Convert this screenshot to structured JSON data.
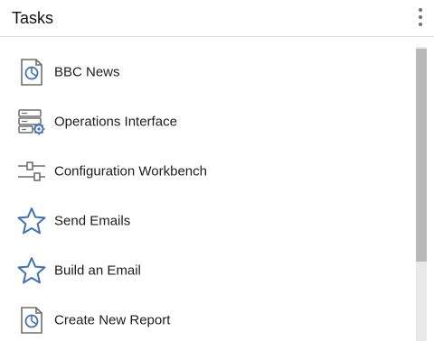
{
  "header": {
    "title": "Tasks",
    "menu_icon": "more-vertical-icon"
  },
  "tasks": [
    {
      "label": "BBC News",
      "icon": "report-document-icon"
    },
    {
      "label": "Operations Interface",
      "icon": "server-gear-icon"
    },
    {
      "label": "Configuration Workbench",
      "icon": "sliders-icon"
    },
    {
      "label": "Send Emails",
      "icon": "star-icon"
    },
    {
      "label": "Build an Email",
      "icon": "star-icon"
    },
    {
      "label": "Create New Report",
      "icon": "report-document-icon"
    }
  ],
  "colors": {
    "icon_gray": "#6f6f6f",
    "icon_blue": "#3f72b8",
    "divider": "#dcdcdc"
  }
}
